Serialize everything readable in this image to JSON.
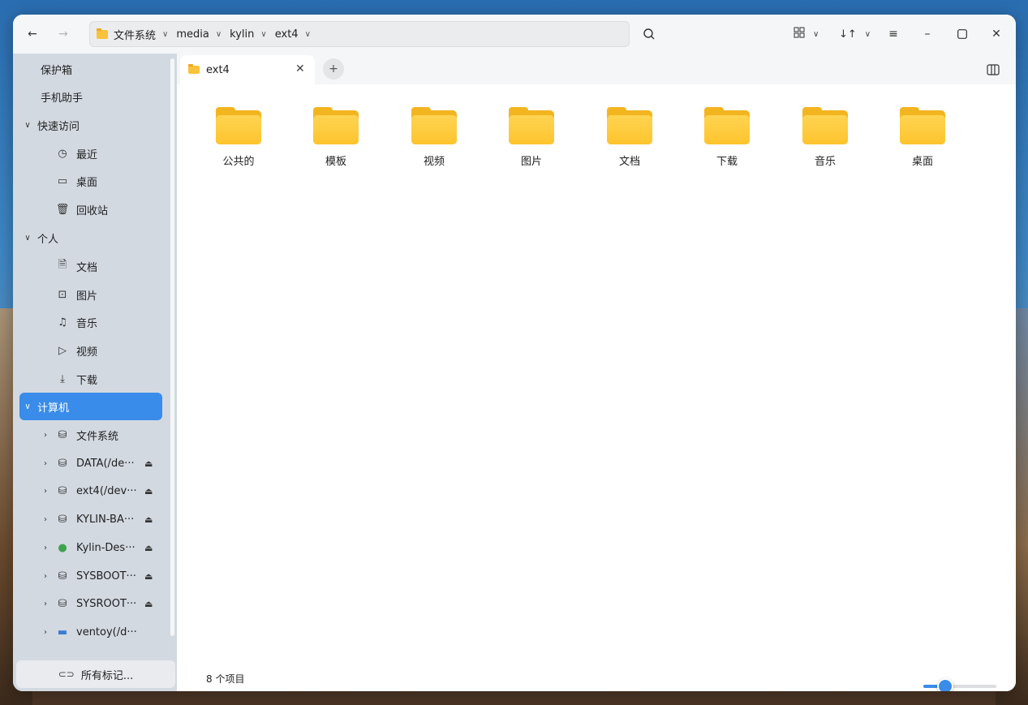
{
  "header": {
    "back_icon": "back-arrow-icon",
    "forward_icon": "forward-arrow-icon",
    "breadcrumbs": [
      "文件系统",
      "media",
      "kylin",
      "ext4"
    ],
    "search_icon": "search-icon",
    "view_mode_icon": "grid-view-icon",
    "sort_icon": "sort-icon",
    "menu_icon": "menu-icon",
    "minimize_icon": "minimize-icon",
    "maximize_icon": "maximize-icon",
    "close_icon": "close-icon"
  },
  "sidebar": {
    "vault": "保护箱",
    "phone": "手机助手",
    "quick_access": "快速访问",
    "quick_items": [
      {
        "label": "最近",
        "icon": "clock-icon"
      },
      {
        "label": "桌面",
        "icon": "desktop-icon"
      },
      {
        "label": "回收站",
        "icon": "trash-icon"
      }
    ],
    "personal": "个人",
    "personal_items": [
      {
        "label": "文档",
        "icon": "document-icon"
      },
      {
        "label": "图片",
        "icon": "picture-icon"
      },
      {
        "label": "音乐",
        "icon": "music-icon"
      },
      {
        "label": "视频",
        "icon": "video-icon"
      },
      {
        "label": "下载",
        "icon": "download-icon"
      }
    ],
    "computer": "计算机",
    "computer_items": [
      {
        "label": "文件系统",
        "icon": "drive-icon",
        "eject": false
      },
      {
        "label": "DATA(/de···",
        "icon": "drive-icon",
        "eject": true
      },
      {
        "label": "ext4(/dev···",
        "icon": "usb-drive-icon",
        "eject": true
      },
      {
        "label": "KYLIN-BA···",
        "icon": "drive-icon",
        "eject": true
      },
      {
        "label": "Kylin-Des···",
        "icon": "disc-icon",
        "eject": true
      },
      {
        "label": "SYSBOOT···",
        "icon": "drive-icon",
        "eject": true
      },
      {
        "label": "SYSROOT···",
        "icon": "drive-icon",
        "eject": true
      },
      {
        "label": "ventoy(/d···",
        "icon": "removable-drive-icon",
        "eject": false
      }
    ],
    "all_tags": "所有标记..."
  },
  "tabs": [
    {
      "label": "ext4"
    }
  ],
  "files": [
    {
      "name": "公共的"
    },
    {
      "name": "模板"
    },
    {
      "name": "视频"
    },
    {
      "name": "图片"
    },
    {
      "name": "文档"
    },
    {
      "name": "下载"
    },
    {
      "name": "音乐"
    },
    {
      "name": "桌面"
    }
  ],
  "status": {
    "item_count": "8 个项目",
    "zoom_level": 0.3
  },
  "colors": {
    "accent": "#3a8cea",
    "folder": "#fdc42e"
  }
}
